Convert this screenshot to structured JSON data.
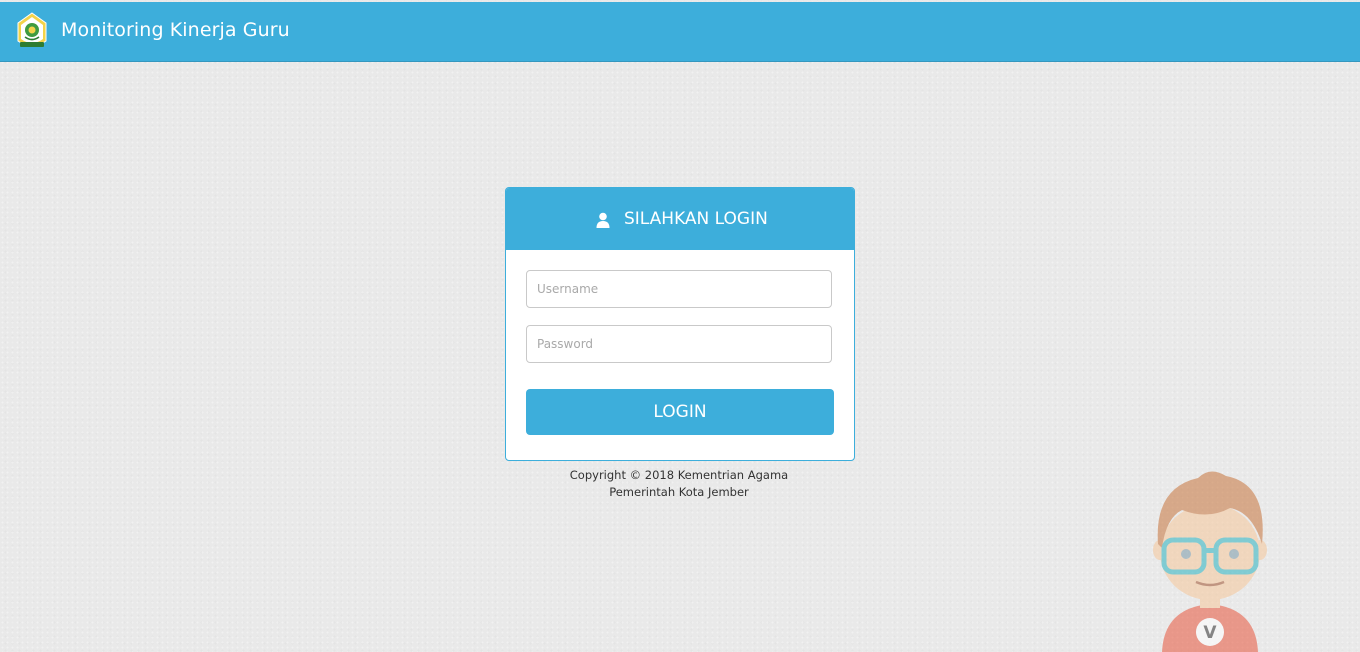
{
  "header": {
    "logo_icon": "ministry-emblem-icon",
    "title": "Monitoring Kinerja Guru",
    "background_color": "#3daedb"
  },
  "login": {
    "heading_icon": "user-icon",
    "heading": "SILAHKAN LOGIN",
    "username_placeholder": "Username",
    "password_placeholder": "Password",
    "button_label": "LOGIN"
  },
  "footer": {
    "copyright_line1": "Copyright © 2018 Kementrian Agama",
    "copyright_line2": "Pemerintah Kota Jember"
  },
  "mascot": {
    "icon": "cartoon-mascot-illustration",
    "shirt_letter": "V"
  }
}
